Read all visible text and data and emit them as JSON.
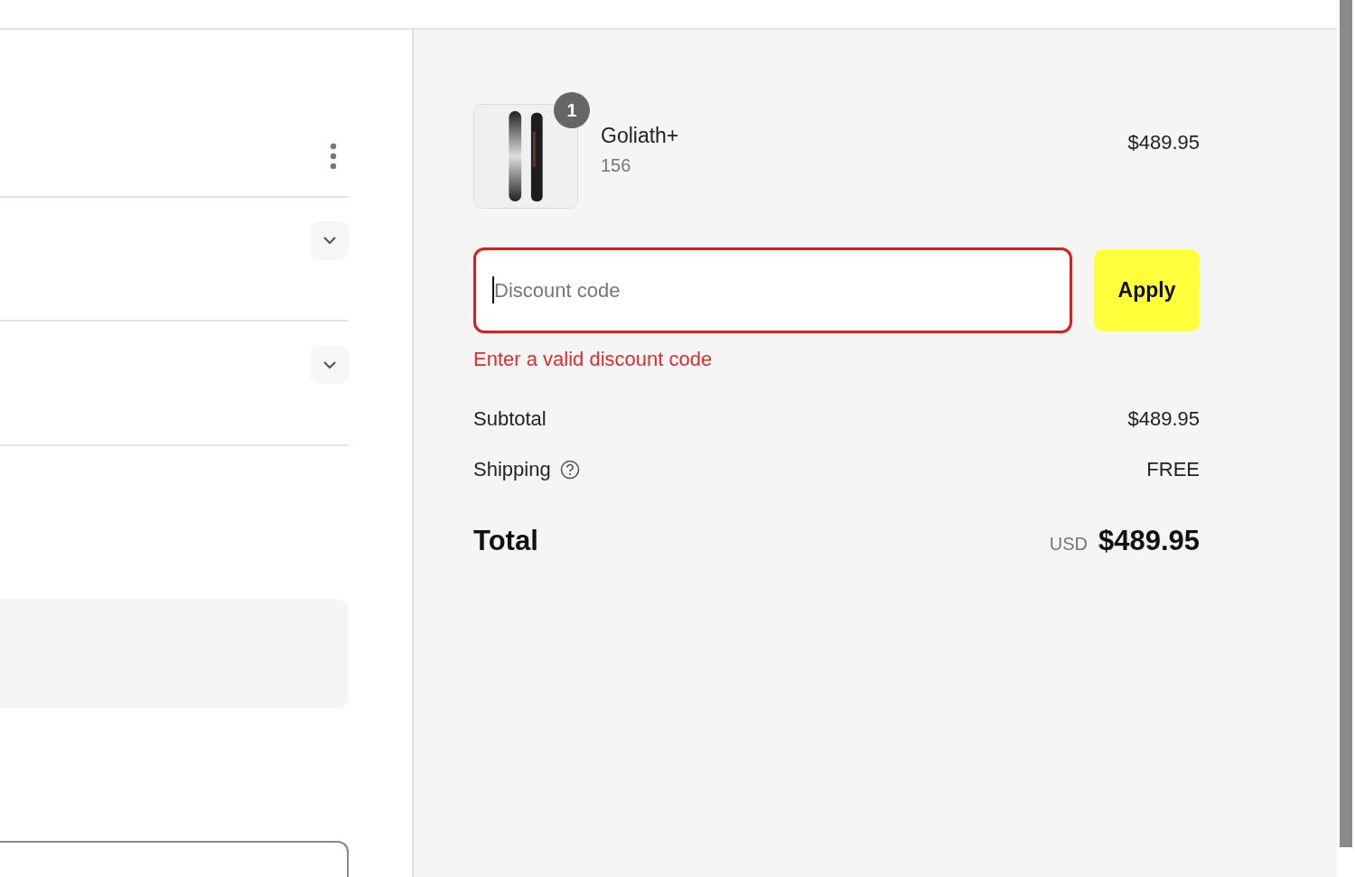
{
  "cart_items": [
    {
      "name": "Goliath+",
      "variant": "156",
      "price": "$489.95",
      "quantity": "1"
    }
  ],
  "discount": {
    "placeholder": "Discount code",
    "invalid": true,
    "button": "Apply",
    "error": "Enter a valid discount code"
  },
  "summary_lines": [
    {
      "label": "Subtotal",
      "value": "$489.95",
      "has_help": false
    },
    {
      "label": "Shipping",
      "value": "FREE",
      "has_help": true
    }
  ],
  "total": {
    "label": "Total",
    "currency": "USD",
    "amount": "$489.95"
  }
}
